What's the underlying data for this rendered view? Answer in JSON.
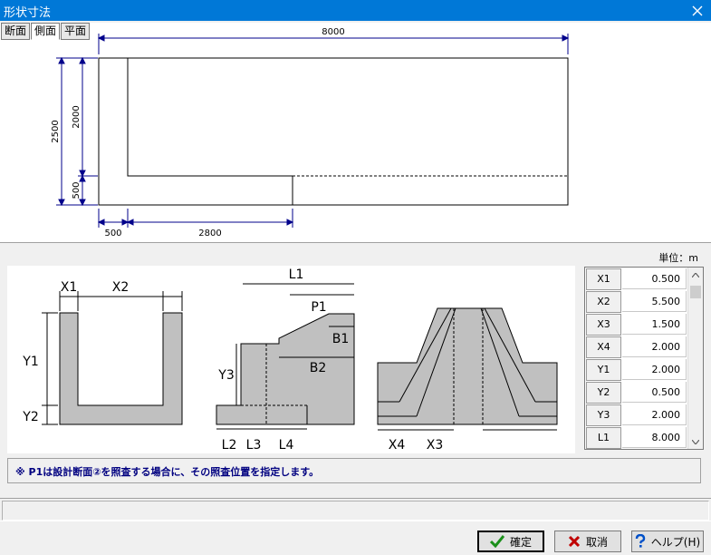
{
  "window": {
    "title": "形状寸法"
  },
  "tabs": [
    {
      "label": "断面",
      "active": false
    },
    {
      "label": "側面",
      "active": true
    },
    {
      "label": "平面",
      "active": false
    }
  ],
  "side_view": {
    "dim_total_width": "8000",
    "dim_total_height": "2500",
    "dim_inner_height": "2000",
    "dim_bottom": "500",
    "dim_wall": "500",
    "dim_opening": "2800"
  },
  "unit_label": "単位：m",
  "diagram_labels": {
    "x1": "X1",
    "x2": "X2",
    "y1": "Y1",
    "y2": "Y2",
    "l1": "L1",
    "p1": "P1",
    "b1": "B1",
    "b2": "B2",
    "y3": "Y3",
    "l2": "L2",
    "l3": "L3",
    "l4": "L4",
    "x4": "X4",
    "x3": "X3"
  },
  "params": [
    {
      "name": "X1",
      "value": "0.500"
    },
    {
      "name": "X2",
      "value": "5.500"
    },
    {
      "name": "X3",
      "value": "1.500"
    },
    {
      "name": "X4",
      "value": "2.000"
    },
    {
      "name": "Y1",
      "value": "2.000"
    },
    {
      "name": "Y2",
      "value": "0.500"
    },
    {
      "name": "Y3",
      "value": "2.000"
    },
    {
      "name": "L1",
      "value": "8.000"
    }
  ],
  "note": "※ P1は設計断面②を照査する場合に、その照査位置を指定します。",
  "buttons": {
    "ok": "確定",
    "cancel": "取消",
    "help": "ヘルプ(H)"
  },
  "colors": {
    "titlebar": "#0078d7",
    "dim_line": "#00008b",
    "fill": "#c0c0c0",
    "note_text": "#000080"
  }
}
